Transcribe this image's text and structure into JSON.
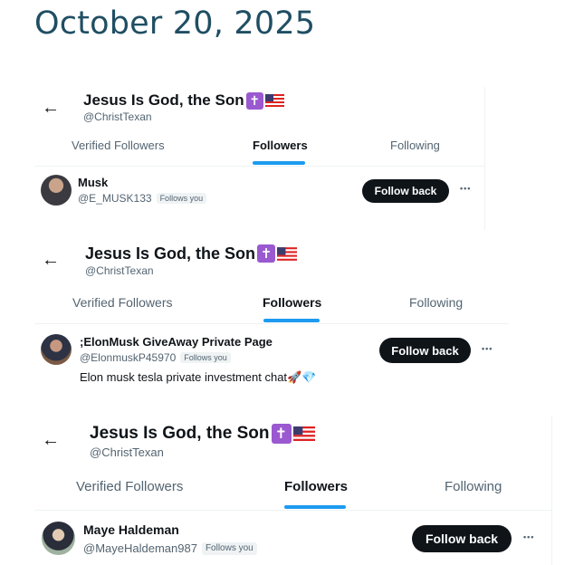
{
  "date_heading": "October 20, 2025",
  "profile": {
    "name": "Jesus Is God, the Son",
    "handle": "@ChristTexan",
    "cross_emoji": "✝",
    "flag_emoji": "us-flag-icon"
  },
  "tabs": {
    "verified": "Verified Followers",
    "followers": "Followers",
    "following": "Following"
  },
  "panels": [
    {
      "user_name": "Musk",
      "user_handle": "@E_MUSK133",
      "badge": "Follows you",
      "button": "Follow back",
      "more": "•••",
      "bio": ""
    },
    {
      "user_name": ";ElonMusk GiveAway Private Page",
      "user_handle": "@ElonmuskP45970",
      "badge": "Follows you",
      "button": "Follow back",
      "more": "•••",
      "bio": "Elon musk tesla private investment chat🚀💎"
    },
    {
      "user_name": "Maye Haldeman",
      "user_handle": "@MayeHaldeman987",
      "badge": "Follows you",
      "button": "Follow back",
      "more": "•••",
      "bio": ""
    }
  ],
  "colors": {
    "accent": "#1d9bf0",
    "button_bg": "#0f1419",
    "secondary_text": "#536471",
    "date_heading": "#1f4e63"
  }
}
